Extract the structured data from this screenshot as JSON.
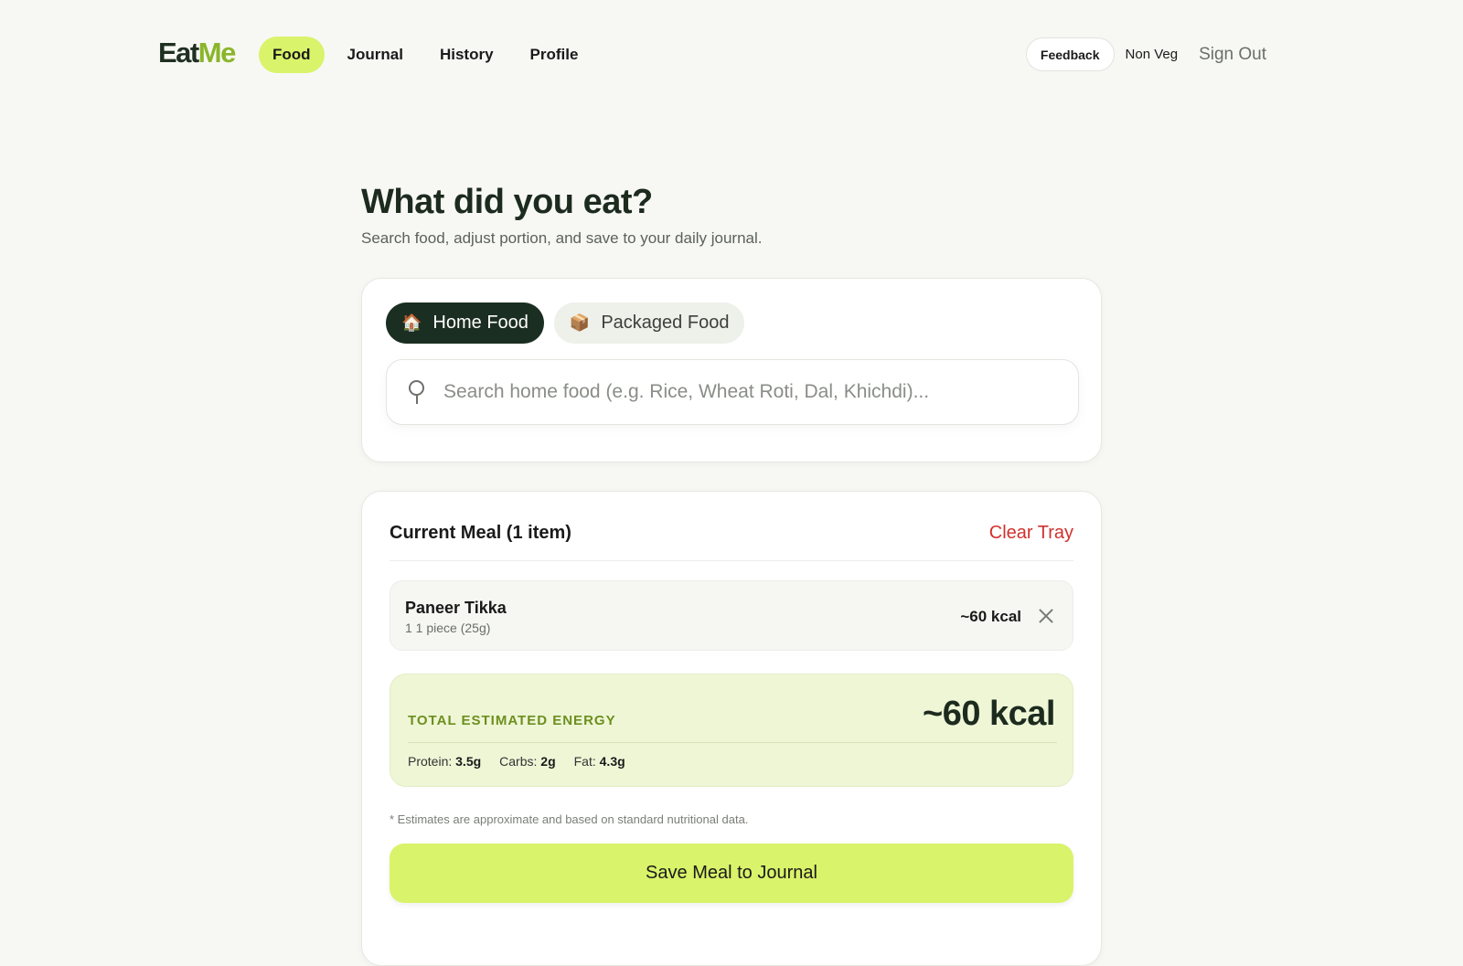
{
  "brand": {
    "part1": "Eat",
    "part2": "Me"
  },
  "nav": {
    "items": [
      {
        "label": "Food",
        "active": true
      },
      {
        "label": "Journal",
        "active": false
      },
      {
        "label": "History",
        "active": false
      },
      {
        "label": "Profile",
        "active": false
      }
    ],
    "feedback_label": "Feedback",
    "diet_label": "Non Veg",
    "signout_label": "Sign Out"
  },
  "page": {
    "title": "What did you eat?",
    "subtitle": "Search food, adjust portion, and save to your daily journal."
  },
  "food_tabs": [
    {
      "label": "Home Food",
      "icon": "house-icon",
      "glyph": "🏠",
      "active": true
    },
    {
      "label": "Packaged Food",
      "icon": "package-icon",
      "glyph": "📦",
      "active": false
    }
  ],
  "search": {
    "placeholder": "Search home food (e.g. Rice, Wheat Roti, Dal, Khichdi)...",
    "value": ""
  },
  "meal": {
    "title": "Current Meal (1 item)",
    "clear_label": "Clear Tray",
    "items": [
      {
        "name": "Paneer Tikka",
        "portion": "1 1 piece (25g)",
        "kcal": "~60 kcal"
      }
    ],
    "energy": {
      "label": "TOTAL ESTIMATED ENERGY",
      "value": "~60 kcal",
      "protein_label": "Protein:",
      "protein": "3.5g",
      "carbs_label": "Carbs:",
      "carbs": "2g",
      "fat_label": "Fat:",
      "fat": "4.3g"
    },
    "disclaimer": "* Estimates are approximate and based on standard nutritional data.",
    "save_label": "Save Meal to Journal"
  },
  "colors": {
    "accent": "#d9f36a",
    "dark": "#1b2e22",
    "danger": "#d0312d",
    "energy_bg": "#eef6d6",
    "energy_label": "#6e8f1e"
  }
}
